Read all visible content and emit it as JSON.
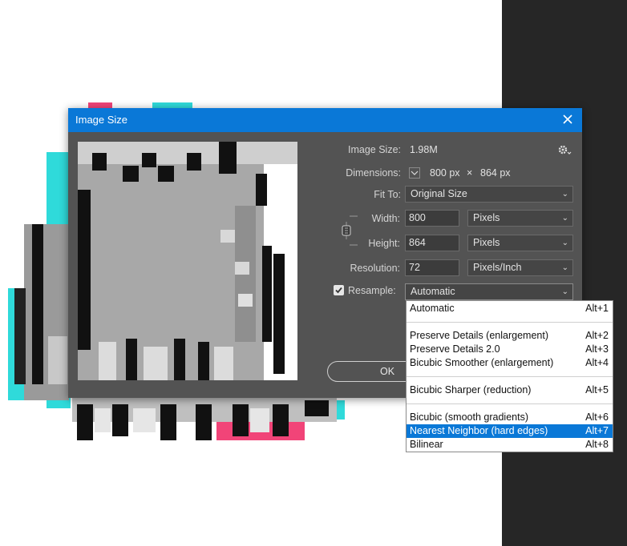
{
  "dialog": {
    "title": "Image Size",
    "image_size_label": "Image Size:",
    "image_size_value": "1.98M",
    "dimensions_label": "Dimensions:",
    "dimensions_width": "800 px",
    "dimensions_times": "×",
    "dimensions_height": "864 px",
    "fit_to_label": "Fit To:",
    "fit_to_value": "Original Size",
    "width_label": "Width:",
    "width_value": "800",
    "width_unit": "Pixels",
    "height_label": "Height:",
    "height_value": "864",
    "height_unit": "Pixels",
    "resolution_label": "Resolution:",
    "resolution_value": "72",
    "resolution_unit": "Pixels/Inch",
    "resample_label": "Resample:",
    "resample_checked": true,
    "resample_value": "Automatic",
    "ok_label": "OK"
  },
  "resample_menu": {
    "items": [
      {
        "label": "Automatic",
        "shortcut": "Alt+1",
        "selected": false
      },
      {
        "label": "Preserve Details (enlargement)",
        "shortcut": "Alt+2",
        "selected": false
      },
      {
        "label": "Preserve Details 2.0",
        "shortcut": "Alt+3",
        "selected": false
      },
      {
        "label": "Bicubic Smoother (enlargement)",
        "shortcut": "Alt+4",
        "selected": false
      },
      {
        "label": "Bicubic Sharper (reduction)",
        "shortcut": "Alt+5",
        "selected": false
      },
      {
        "label": "Bicubic (smooth gradients)",
        "shortcut": "Alt+6",
        "selected": false
      },
      {
        "label": "Nearest Neighbor (hard edges)",
        "shortcut": "Alt+7",
        "selected": true
      },
      {
        "label": "Bilinear",
        "shortcut": "Alt+8",
        "selected": false
      }
    ]
  },
  "icons": {
    "close": "close-icon",
    "settings": "gear-icon",
    "link": "chain-link-icon",
    "dropdown": "chevron-down-icon",
    "checkbox": "checkbox-checked-icon"
  },
  "colors": {
    "accent": "#0a78d7",
    "dialog_bg": "#535353",
    "side_panel": "#262626"
  }
}
